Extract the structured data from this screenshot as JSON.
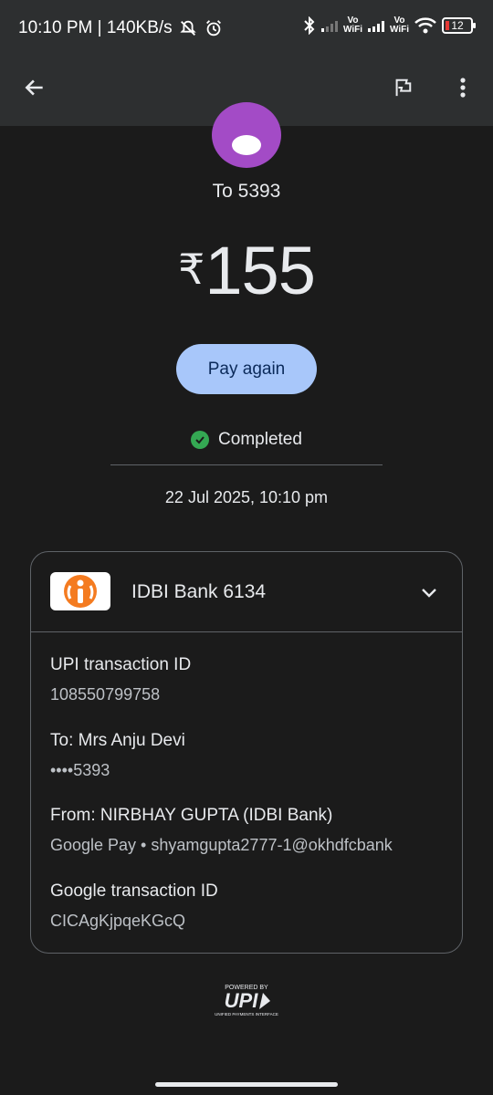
{
  "status_bar": {
    "time_speed": "10:10 PM | 140KB/s",
    "sim1_label_top": "Vo",
    "sim1_label_bottom": "WiFi",
    "sim2_label_top": "Vo",
    "sim2_label_bottom": "WiFi",
    "battery": "12"
  },
  "recipient": "To 5393",
  "amount": {
    "currency": "₹",
    "value": "155"
  },
  "pay_again_label": "Pay again",
  "status": {
    "text": "Completed",
    "color": "#34a853"
  },
  "datetime": "22 Jul 2025, 10:10 pm",
  "card": {
    "bank_name": "IDBI Bank 6134",
    "details": [
      {
        "label": "UPI transaction ID",
        "value": "108550799758"
      },
      {
        "label": "To: Mrs Anju  Devi",
        "value": "••••5393"
      },
      {
        "label": "From: NIRBHAY GUPTA (IDBI Bank)",
        "value": "Google Pay • shyamgupta2777-1@okhdfcbank"
      },
      {
        "label": "Google transaction ID",
        "value": "CICAgKjpqeKGcQ"
      }
    ]
  },
  "upi_logo": {
    "powered_by": "POWERED BY",
    "brand": "UPI",
    "tagline": "UNIFIED PAYMENTS INTERFACE"
  },
  "icons": [
    "back-arrow-icon",
    "flag-icon",
    "more-vert-icon",
    "chevron-down-icon",
    "check-circle-icon",
    "avatar-icon",
    "bank-logo-icon",
    "upi-logo-icon"
  ],
  "colors": {
    "background": "#1b1b1b",
    "app_bar": "#2d2f30",
    "button": "#a8c7fa",
    "avatar": "#a34bc6"
  }
}
